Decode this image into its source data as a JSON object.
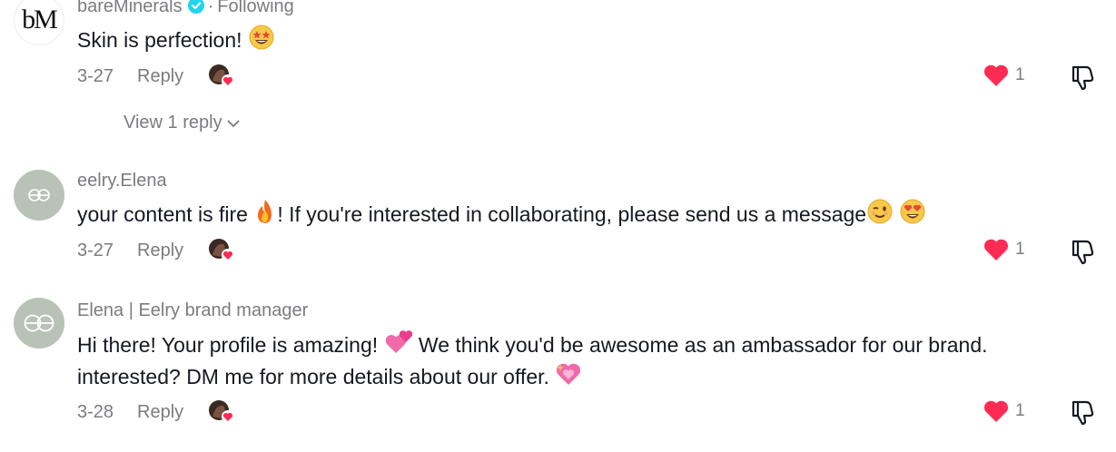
{
  "comments": [
    {
      "avatar_text": "bM",
      "username": "bareMinerals",
      "verified": true,
      "following_label": "Following",
      "text": "Skin is perfection!",
      "emoji": "star-struck-emoji",
      "date": "3-27",
      "reply_label": "Reply",
      "like_count": "1",
      "view_replies_label": "View 1 reply"
    },
    {
      "username": "eelry.Elena",
      "text_before": "your content is fire",
      "text_middle": "! If you're interested in collaborating, please send us a message",
      "emojis": [
        "fire-emoji",
        "winking-face-emoji",
        "heart-eyes-emoji"
      ],
      "date": "3-27",
      "reply_label": "Reply",
      "like_count": "1"
    },
    {
      "username": "Elena | Eelry brand manager",
      "text_line1_a": "Hi there! Your profile is amazing!",
      "text_line1_b": "We think you'd be awesome as an ambassador for our brand.",
      "text_line2": "interested? DM me for more details about our offer.",
      "emojis": [
        "two-hearts-emoji",
        "sparkling-heart-emoji"
      ],
      "date": "3-28",
      "reply_label": "Reply",
      "like_count": "1"
    }
  ],
  "colors": {
    "like_red": "#fe2c55",
    "secondary_text": "#7b7c80",
    "verified_blue": "#20d5ec"
  }
}
